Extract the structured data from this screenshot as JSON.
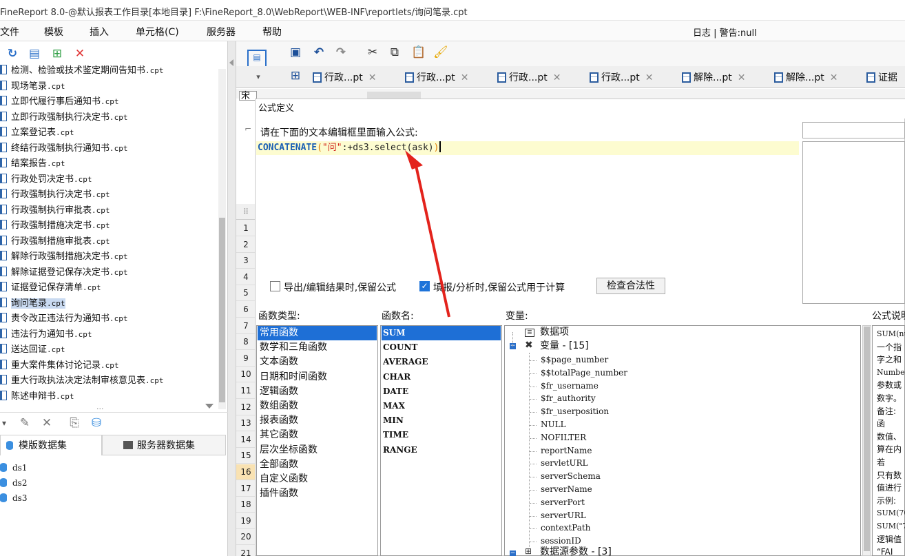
{
  "window": {
    "title": "FineReport 8.0-@默认报表工作目录[本地目录]    F:\\FineReport_8.0\\WebReport\\WEB-INF\\reportlets/询问笔录.cpt"
  },
  "menu": {
    "items": [
      "文件",
      "模板",
      "插入",
      "单元格(C)",
      "服务器",
      "帮助"
    ],
    "right": "日志 | 警告:null"
  },
  "file_tree": {
    "items": [
      {
        "name": "检测、检验或技术鉴定期间告知书",
        "ext": ".cpt"
      },
      {
        "name": "现场笔录",
        "ext": ".cpt"
      },
      {
        "name": "立即代履行事后通知书",
        "ext": ".cpt"
      },
      {
        "name": "立即行政强制执行决定书",
        "ext": ".cpt"
      },
      {
        "name": "立案登记表",
        "ext": ".cpt"
      },
      {
        "name": "终结行政强制执行通知书",
        "ext": ".cpt"
      },
      {
        "name": "结案报告",
        "ext": ".cpt"
      },
      {
        "name": "行政处罚决定书",
        "ext": ".cpt"
      },
      {
        "name": "行政强制执行决定书",
        "ext": ".cpt"
      },
      {
        "name": "行政强制执行审批表",
        "ext": ".cpt"
      },
      {
        "name": "行政强制措施决定书",
        "ext": ".cpt"
      },
      {
        "name": "行政强制措施审批表",
        "ext": ".cpt"
      },
      {
        "name": "解除行政强制措施决定书",
        "ext": ".cpt"
      },
      {
        "name": "解除证据登记保存决定书",
        "ext": ".cpt"
      },
      {
        "name": "证据登记保存清单",
        "ext": ".cpt"
      },
      {
        "name": "询问笔录",
        "ext": ".cpt",
        "selected": true
      },
      {
        "name": "责令改正违法行为通知书",
        "ext": ".cpt"
      },
      {
        "name": "违法行为通知书",
        "ext": ".cpt"
      },
      {
        "name": "送达回证",
        "ext": ".cpt"
      },
      {
        "name": "重大案件集体讨论记录",
        "ext": ".cpt"
      },
      {
        "name": "重大行政执法决定法制审核意见表",
        "ext": ".cpt"
      },
      {
        "name": "陈述申辩书",
        "ext": ".cpt"
      }
    ],
    "more": "..."
  },
  "datasets": {
    "tabs": [
      "模版数据集",
      "服务器数据集"
    ],
    "items": [
      "ds1",
      "ds2",
      "ds3"
    ]
  },
  "file_tabs": [
    {
      "label": "行政...pt"
    },
    {
      "label": "行政...pt"
    },
    {
      "label": "行政...pt"
    },
    {
      "label": "行政...pt"
    },
    {
      "label": "解除...pt"
    },
    {
      "label": "解除...pt"
    },
    {
      "label": "证据"
    }
  ],
  "font_box": "宋",
  "row_numbers": [
    "1",
    "2",
    "3",
    "4",
    "5",
    "6",
    "7",
    "8",
    "9",
    "10",
    "11",
    "12",
    "13",
    "14",
    "15",
    "16",
    "17",
    "18",
    "19",
    "20",
    "21"
  ],
  "highlight_row": "16",
  "dialog": {
    "title": "公式定义",
    "prompt": "请在下面的文本编辑框里面输入公式:",
    "formula": {
      "fn": "CONCATENATE",
      "open": "(",
      "str": "\"问\"",
      "rest": ":+ds3.select(ask)",
      "close": ")"
    },
    "options": {
      "export_keep": {
        "label": "导出/编辑结果时,保留公式",
        "checked": false
      },
      "fill_keep": {
        "label": "填报/分析时,保留公式用于计算",
        "checked": true
      }
    },
    "check_button": "检查合法性",
    "function_types": {
      "label": "函数类型:",
      "items": [
        "常用函数",
        "数学和三角函数",
        "文本函数",
        "日期和时间函数",
        "逻辑函数",
        "数组函数",
        "报表函数",
        "其它函数",
        "层次坐标函数",
        "全部函数",
        "自定义函数",
        "插件函数"
      ],
      "selected": "常用函数"
    },
    "function_names": {
      "label": "函数名:",
      "items": [
        "SUM",
        "COUNT",
        "AVERAGE",
        "CHAR",
        "DATE",
        "MAX",
        "MIN",
        "TIME",
        "RANGE"
      ],
      "selected": "SUM"
    },
    "variables": {
      "label": "变量:",
      "data_item": "数据项",
      "var_group": "变量 - [15]",
      "vars": [
        "$$page_number",
        "$$totalPage_number",
        "$fr_username",
        "$fr_authority",
        "$fr_userposition",
        "NULL",
        "NOFILTER",
        "reportName",
        "servletURL",
        "serverSchema",
        "serverName",
        "serverPort",
        "serverURL",
        "contextPath",
        "sessionID"
      ],
      "ds_params": "数据源参数 - [3]"
    },
    "description": {
      "label": "公式说明",
      "lines": [
        "SUM(nu",
        "一个指",
        "字之和",
        "Number",
        "参数或",
        "数字。",
        "备注:",
        "    函",
        "数值、",
        "算在内",
        "    若",
        "只有数",
        "值进行",
        "示例:",
        "SUM(70",
        "SUM(\"7",
        "逻辑值",
        "“FAI"
      ]
    }
  },
  "colors": {
    "selection": "#1e6fd6",
    "arrow": "#e3231c",
    "formula_fn": "#1a5fb4",
    "formula_str": "#d0231b",
    "editor_line": "#fdfcd0"
  }
}
